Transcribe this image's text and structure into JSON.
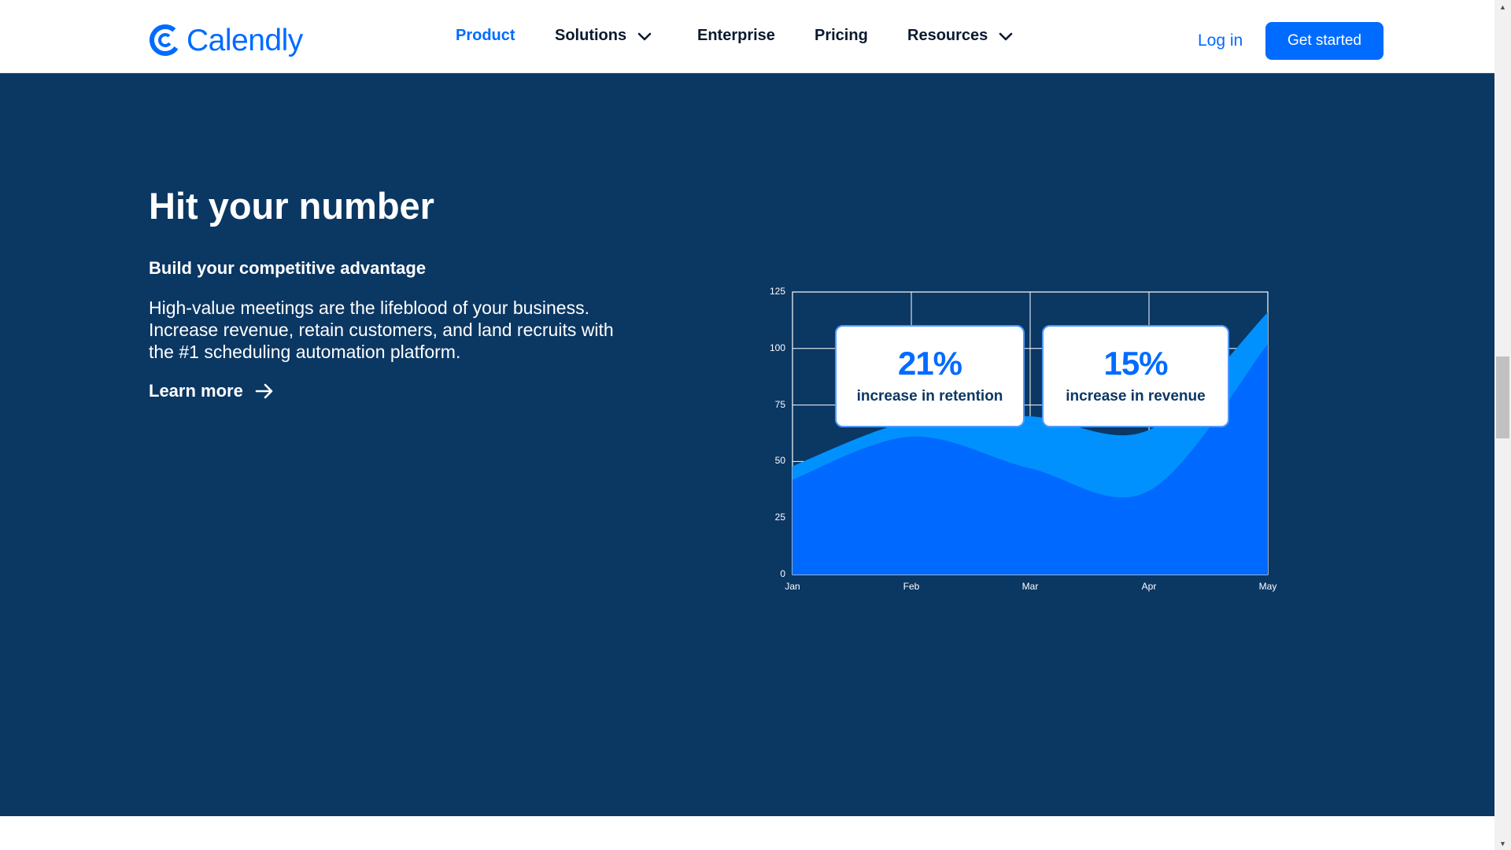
{
  "header": {
    "logo_text": "Calendly",
    "nav": [
      {
        "label": "Product",
        "active": true,
        "has_dropdown": false
      },
      {
        "label": "Solutions",
        "active": false,
        "has_dropdown": true
      },
      {
        "label": "Enterprise",
        "active": false,
        "has_dropdown": false
      },
      {
        "label": "Pricing",
        "active": false,
        "has_dropdown": false
      },
      {
        "label": "Resources",
        "active": false,
        "has_dropdown": true
      }
    ],
    "login_label": "Log in",
    "cta_label": "Get started"
  },
  "hero": {
    "title": "Hit your number",
    "subtitle": "Build your competitive advantage",
    "body": "High-value meetings are the lifeblood of your business. Increase revenue, retain customers, and land recruits with the #1 scheduling automation platform.",
    "link_label": "Learn more"
  },
  "stats": [
    {
      "value": "21%",
      "label": "increase in retention"
    },
    {
      "value": "15%",
      "label": "increase in revenue"
    }
  ],
  "colors": {
    "brand": "#006bff",
    "hero_bg": "#0b3763",
    "series_back": "#0091ff",
    "series_front": "#0069ff"
  },
  "chart_data": {
    "type": "area",
    "x": [
      "Jan",
      "Feb",
      "Mar",
      "Apr",
      "May"
    ],
    "xlabel": "",
    "ylabel": "",
    "ylim": [
      0,
      125
    ],
    "yticks": [
      0,
      25,
      50,
      75,
      100,
      125
    ],
    "grid": true,
    "series": [
      {
        "values": [
          48,
          68,
          70,
          64,
          116
        ]
      },
      {
        "values": [
          42,
          61,
          47,
          37,
          102
        ]
      }
    ]
  }
}
